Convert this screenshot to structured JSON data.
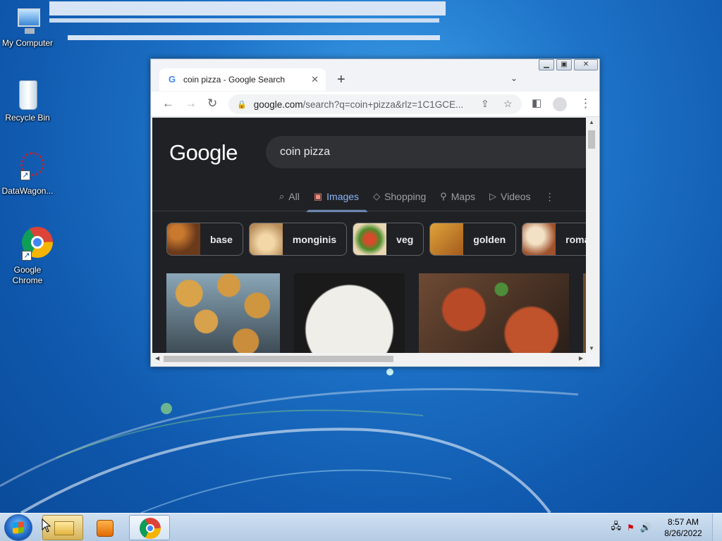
{
  "desktop": {
    "icons": [
      {
        "label": "My Computer"
      },
      {
        "label": "Recycle Bin"
      },
      {
        "label": "DataWagon..."
      },
      {
        "label": "Google Chrome"
      }
    ]
  },
  "browser": {
    "tab_title": "coin pizza - Google Search",
    "url_main": "google.com",
    "url_rest": "/search?q=coin+pizza&rlz=1C1GCE...",
    "google_logo": "Google",
    "search_query": "coin pizza",
    "search_tabs": [
      {
        "label": "All",
        "icon": "search-icon",
        "active": false
      },
      {
        "label": "Images",
        "icon": "image-icon",
        "active": true
      },
      {
        "label": "Shopping",
        "icon": "tag-icon",
        "active": false
      },
      {
        "label": "Maps",
        "icon": "map-pin-icon",
        "active": false
      },
      {
        "label": "Videos",
        "icon": "video-icon",
        "active": false
      }
    ],
    "chips": [
      "base",
      "monginis",
      "veg",
      "golden",
      "roman"
    ]
  },
  "taskbar": {
    "time": "8:57 AM",
    "date": "8/26/2022"
  },
  "colors": {
    "google_dark_bg": "#202124",
    "active_tab": "#8ab4f8"
  }
}
